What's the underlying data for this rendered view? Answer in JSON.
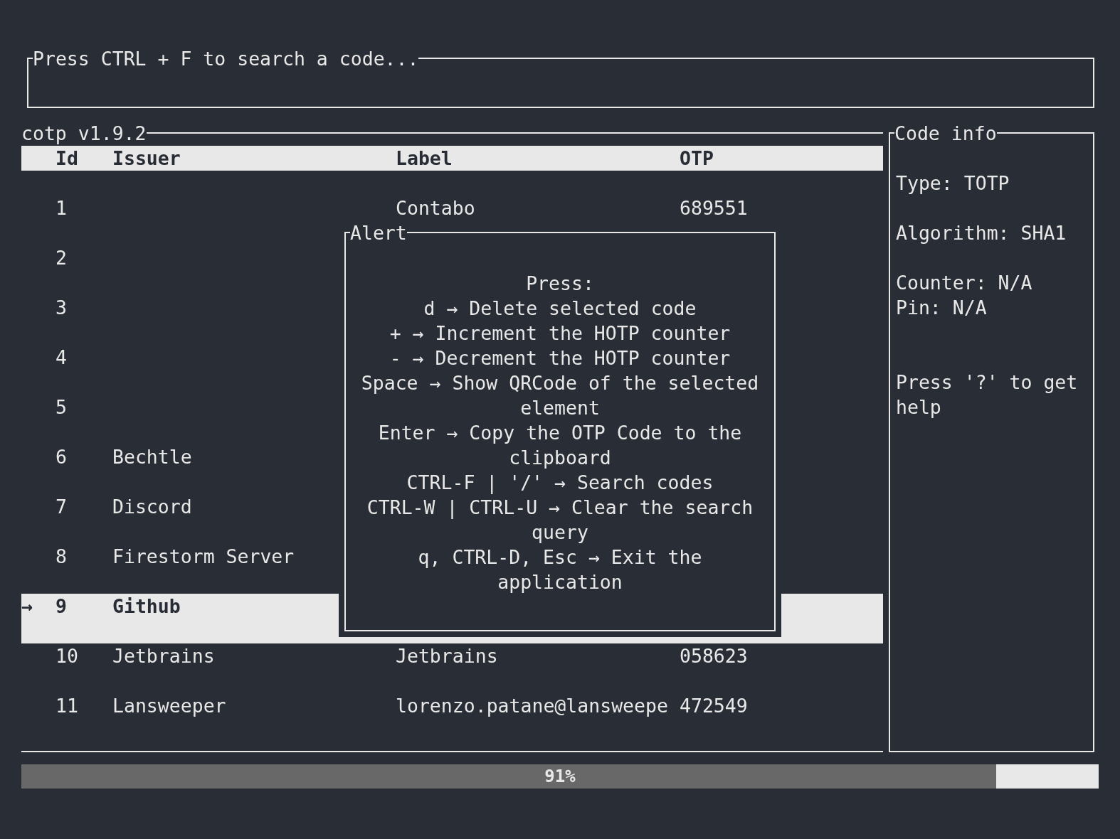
{
  "search": {
    "placeholder": "Press CTRL + F to search a code..."
  },
  "table": {
    "title": "cotp v1.9.2",
    "highlight_symbol": "→",
    "columns": [
      "Id",
      "Issuer",
      "Label",
      "OTP"
    ],
    "rows": [
      {
        "id": "1",
        "label": "Contabo",
        "otp": "689551",
        "selected": false
      },
      {
        "id": "2",
        "selected": false
      },
      {
        "id": "3",
        "selected": false
      },
      {
        "id": "4",
        "selected": false
      },
      {
        "id": "5",
        "selected": false
      },
      {
        "id": "6",
        "issuer": "Bechtle",
        "selected": false
      },
      {
        "id": "7",
        "issuer": "Discord",
        "selected": false
      },
      {
        "id": "8",
        "issuer": "Firestorm Server",
        "selected": false
      },
      {
        "id": "9",
        "issuer": "Github",
        "selected": true
      },
      {
        "id": "10",
        "issuer": "Jetbrains",
        "label": "Jetbrains",
        "otp": "058623",
        "selected": false
      },
      {
        "id": "11",
        "issuer": "Lansweeper",
        "label": "lorenzo.patane@lansweepe",
        "otp": "472549",
        "selected": false
      }
    ]
  },
  "code_info": {
    "title": "Code info",
    "lines": [
      "Type: TOTP",
      "Algorithm: SHA1",
      "Counter: N/A",
      "Pin: N/A",
      "Press '?' to get help"
    ]
  },
  "alert": {
    "title": "Alert",
    "lines": [
      "Press:",
      "d → Delete selected code",
      "+ → Increment the HOTP counter",
      "- → Decrement the HOTP counter",
      "Space → Show QRCode of the selected element",
      "Enter → Copy the OTP Code to the clipboard",
      "CTRL-F | '/' → Search codes",
      "CTRL-W | CTRL-U → Clear the search query",
      "q, CTRL-D, Esc → Exit the application"
    ]
  },
  "progress": {
    "label": "91%",
    "level": 0.905
  }
}
